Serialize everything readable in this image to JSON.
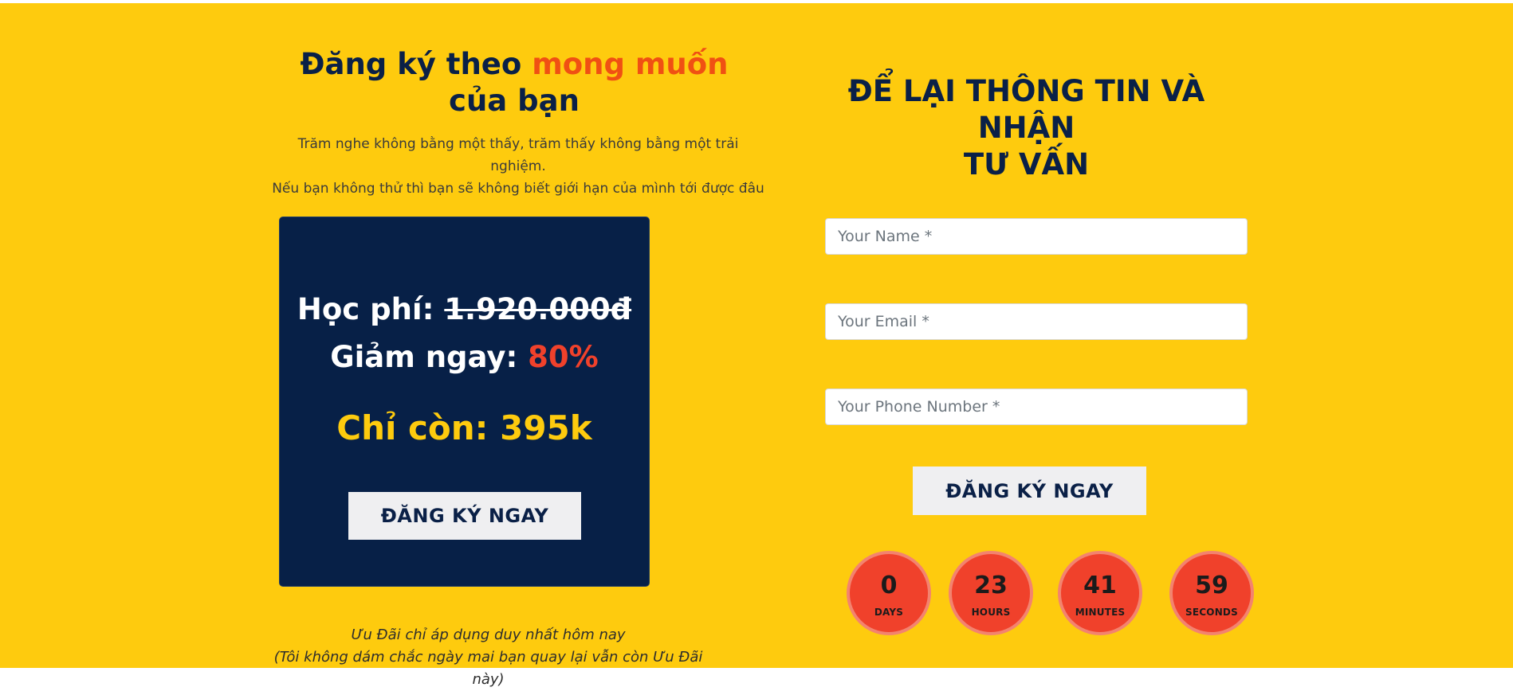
{
  "left": {
    "heading_part1": "Đăng ký theo ",
    "heading_accent": "mong muốn",
    "heading_part2": "của bạn",
    "subtext_line1": "Trăm nghe không bằng một thấy, trăm thấy không bằng một trải nghiệm.",
    "subtext_line2": "Nếu bạn không thử thì bạn sẽ không biết giới hạn của mình tới được đâu",
    "card": {
      "fee_label": "Học phí: ",
      "fee_original": "1.920.000đ",
      "discount_label": "Giảm ngay: ",
      "discount_value": "80%",
      "final_price": "Chỉ còn: 395k",
      "button_label": "ĐĂNG KÝ NGAY"
    },
    "note_line1": "Ưu Đãi chỉ áp dụng duy nhất hôm nay",
    "note_line2": "(Tôi không dám chắc ngày mai bạn quay lại vẫn còn Ưu Đãi này)"
  },
  "form": {
    "title_line1": "ĐỂ LẠI THÔNG TIN VÀ NHẬN",
    "title_line2": "TƯ VẤN",
    "name_placeholder": "Your Name *",
    "email_placeholder": "Your Email *",
    "phone_placeholder": "Your Phone Number *",
    "submit_label": "ĐĂNG KÝ NGAY"
  },
  "countdown": [
    {
      "value": "0",
      "label": "DAYS"
    },
    {
      "value": "23",
      "label": "HOURS"
    },
    {
      "value": "41",
      "label": "MINUTES"
    },
    {
      "value": "59",
      "label": "SECONDS"
    }
  ],
  "colors": {
    "background": "#fecb0e",
    "navy": "#072047",
    "accent_orange": "#f05013",
    "red": "#f0412b",
    "button_bg": "#efeff1"
  }
}
